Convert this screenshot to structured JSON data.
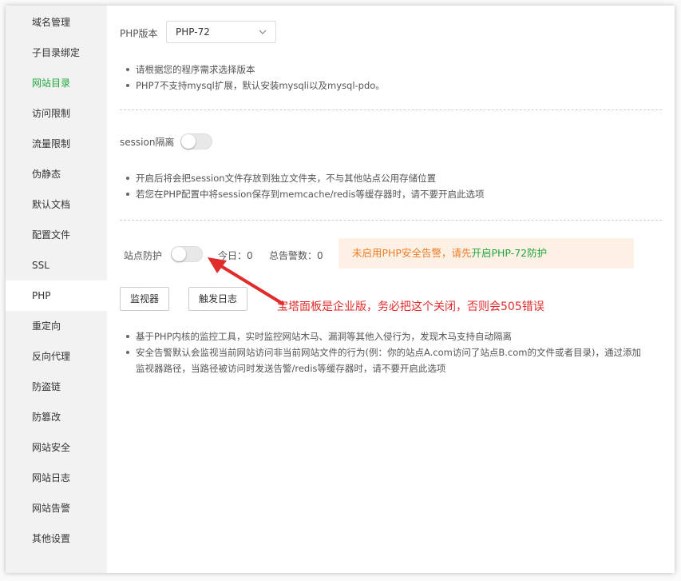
{
  "sidebar": {
    "items": [
      {
        "label": "域名管理"
      },
      {
        "label": "子目录绑定"
      },
      {
        "label": "网站目录"
      },
      {
        "label": "访问限制"
      },
      {
        "label": "流量限制"
      },
      {
        "label": "伪静态"
      },
      {
        "label": "默认文档"
      },
      {
        "label": "配置文件"
      },
      {
        "label": "SSL"
      },
      {
        "label": "PHP"
      },
      {
        "label": "重定向"
      },
      {
        "label": "反向代理"
      },
      {
        "label": "防盗链"
      },
      {
        "label": "防篡改"
      },
      {
        "label": "网站安全"
      },
      {
        "label": "网站日志"
      },
      {
        "label": "网站告警"
      },
      {
        "label": "其他设置"
      }
    ],
    "highlighted_item": "网站目录",
    "active_item": "PHP",
    "highlight_color": "#20a53a"
  },
  "php_version": {
    "label": "PHP版本",
    "selected": "PHP-72",
    "tips": [
      "请根据您的程序需求选择版本",
      "PHP7不支持mysql扩展，默认安装mysqli以及mysql-pdo。"
    ]
  },
  "session": {
    "label": "session隔离",
    "enabled": false,
    "tips": [
      "开启后将会把session文件存放到独立文件夹，不与其他站点公用存储位置",
      "若您在PHP配置中将session保存到memcache/redis等缓存器时，请不要开启此选项"
    ]
  },
  "site_protection": {
    "label": "站点防护",
    "enabled": false,
    "today_text": "今日：0",
    "total_alerts_text": "总告警数：0",
    "alert_warn_text": "未启用PHP安全告警，请先",
    "alert_link_text": "开启PHP-72防护",
    "alert_warn_color": "#ee7d27",
    "monitor_button": "监视器",
    "trigger_log_button": "触发日志",
    "tips": [
      "基于PHP内核的监控工具，实时监控网站木马、漏洞等其他入侵行为，发现木马支持自动隔离",
      "安全告警默认会监视当前网站访问非当前网站文件的行为(例：你的站点A.com访问了站点B.com的文件或者目录)，通过添加",
      "监视器路径，当路径被访问时发送告警/redis等缓存器时，请不要开启此选项"
    ]
  },
  "annotation": {
    "text": "宝塔面板是企业版，务必把这个关闭，否则会505错误",
    "color": "#e12c2c",
    "arrow_icon": "red-arrow-icon"
  }
}
